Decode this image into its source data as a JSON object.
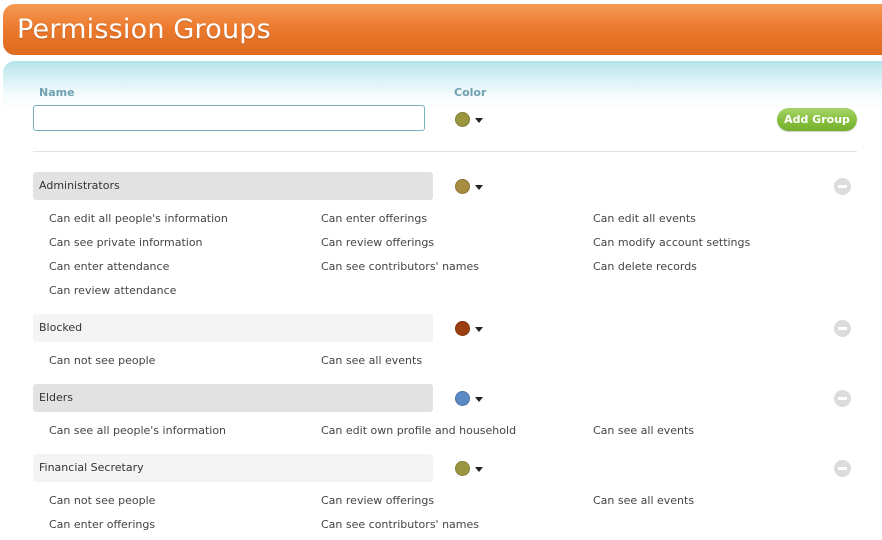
{
  "header": {
    "title": "Permission Groups"
  },
  "form": {
    "name_label": "Name",
    "color_label": "Color",
    "name_value": "",
    "selected_color": "#9a9640",
    "add_button": "Add Group"
  },
  "groups": [
    {
      "name": "Administrators",
      "color": "#a68c40",
      "permissions": [
        "Can edit all people's information",
        "Can enter offerings",
        "Can edit all events",
        "Can see private information",
        "Can review offerings",
        "Can modify account settings",
        "Can enter attendance",
        "Can see contributors' names",
        "Can delete records",
        "Can review attendance"
      ]
    },
    {
      "name": "Blocked",
      "color": "#9a3e0f",
      "permissions": [
        "Can not see people",
        "Can see all events"
      ]
    },
    {
      "name": "Elders",
      "color": "#5a8ac6",
      "permissions": [
        "Can see all people's information",
        "Can edit own profile and household",
        "Can see all events"
      ]
    },
    {
      "name": "Financial Secretary",
      "color": "#9a9640",
      "permissions": [
        "Can not see people",
        "Can review offerings",
        "Can see all events",
        "Can enter offerings",
        "Can see contributors' names"
      ]
    }
  ],
  "icons": {
    "remove": "minus-circle-icon",
    "dropdown": "caret-down-icon"
  }
}
